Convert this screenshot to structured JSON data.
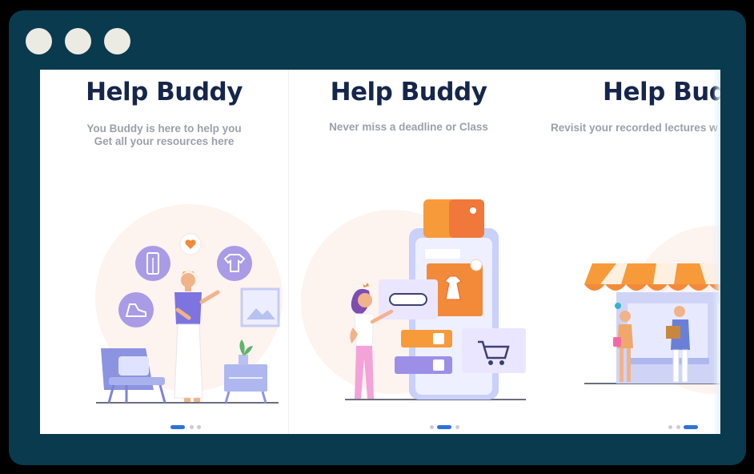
{
  "window": {
    "controls": [
      "window-dot",
      "window-dot",
      "window-dot"
    ],
    "colors": {
      "frame": "#0a3a4e",
      "dot": "#ecebe3",
      "title": "#16264a",
      "subtitle": "#9aa0ab",
      "accent": "#2f73d6"
    }
  },
  "slides": [
    {
      "title": "Help Buddy",
      "subtitle_lines": [
        "You Buddy is here to help you",
        "Get all your resources here"
      ],
      "illustration": "shopping-assistant-illustration",
      "pager_active": 1
    },
    {
      "title": "Help Buddy",
      "subtitle_lines": [
        "Never miss a deadline or Class"
      ],
      "illustration": "mobile-shopping-illustration",
      "pager_active": 2
    },
    {
      "title": "Help Bud",
      "subtitle_lines": [
        "Revisit your recorded lectures w"
      ],
      "illustration": "storefront-illustration",
      "pager_active": 3
    }
  ]
}
